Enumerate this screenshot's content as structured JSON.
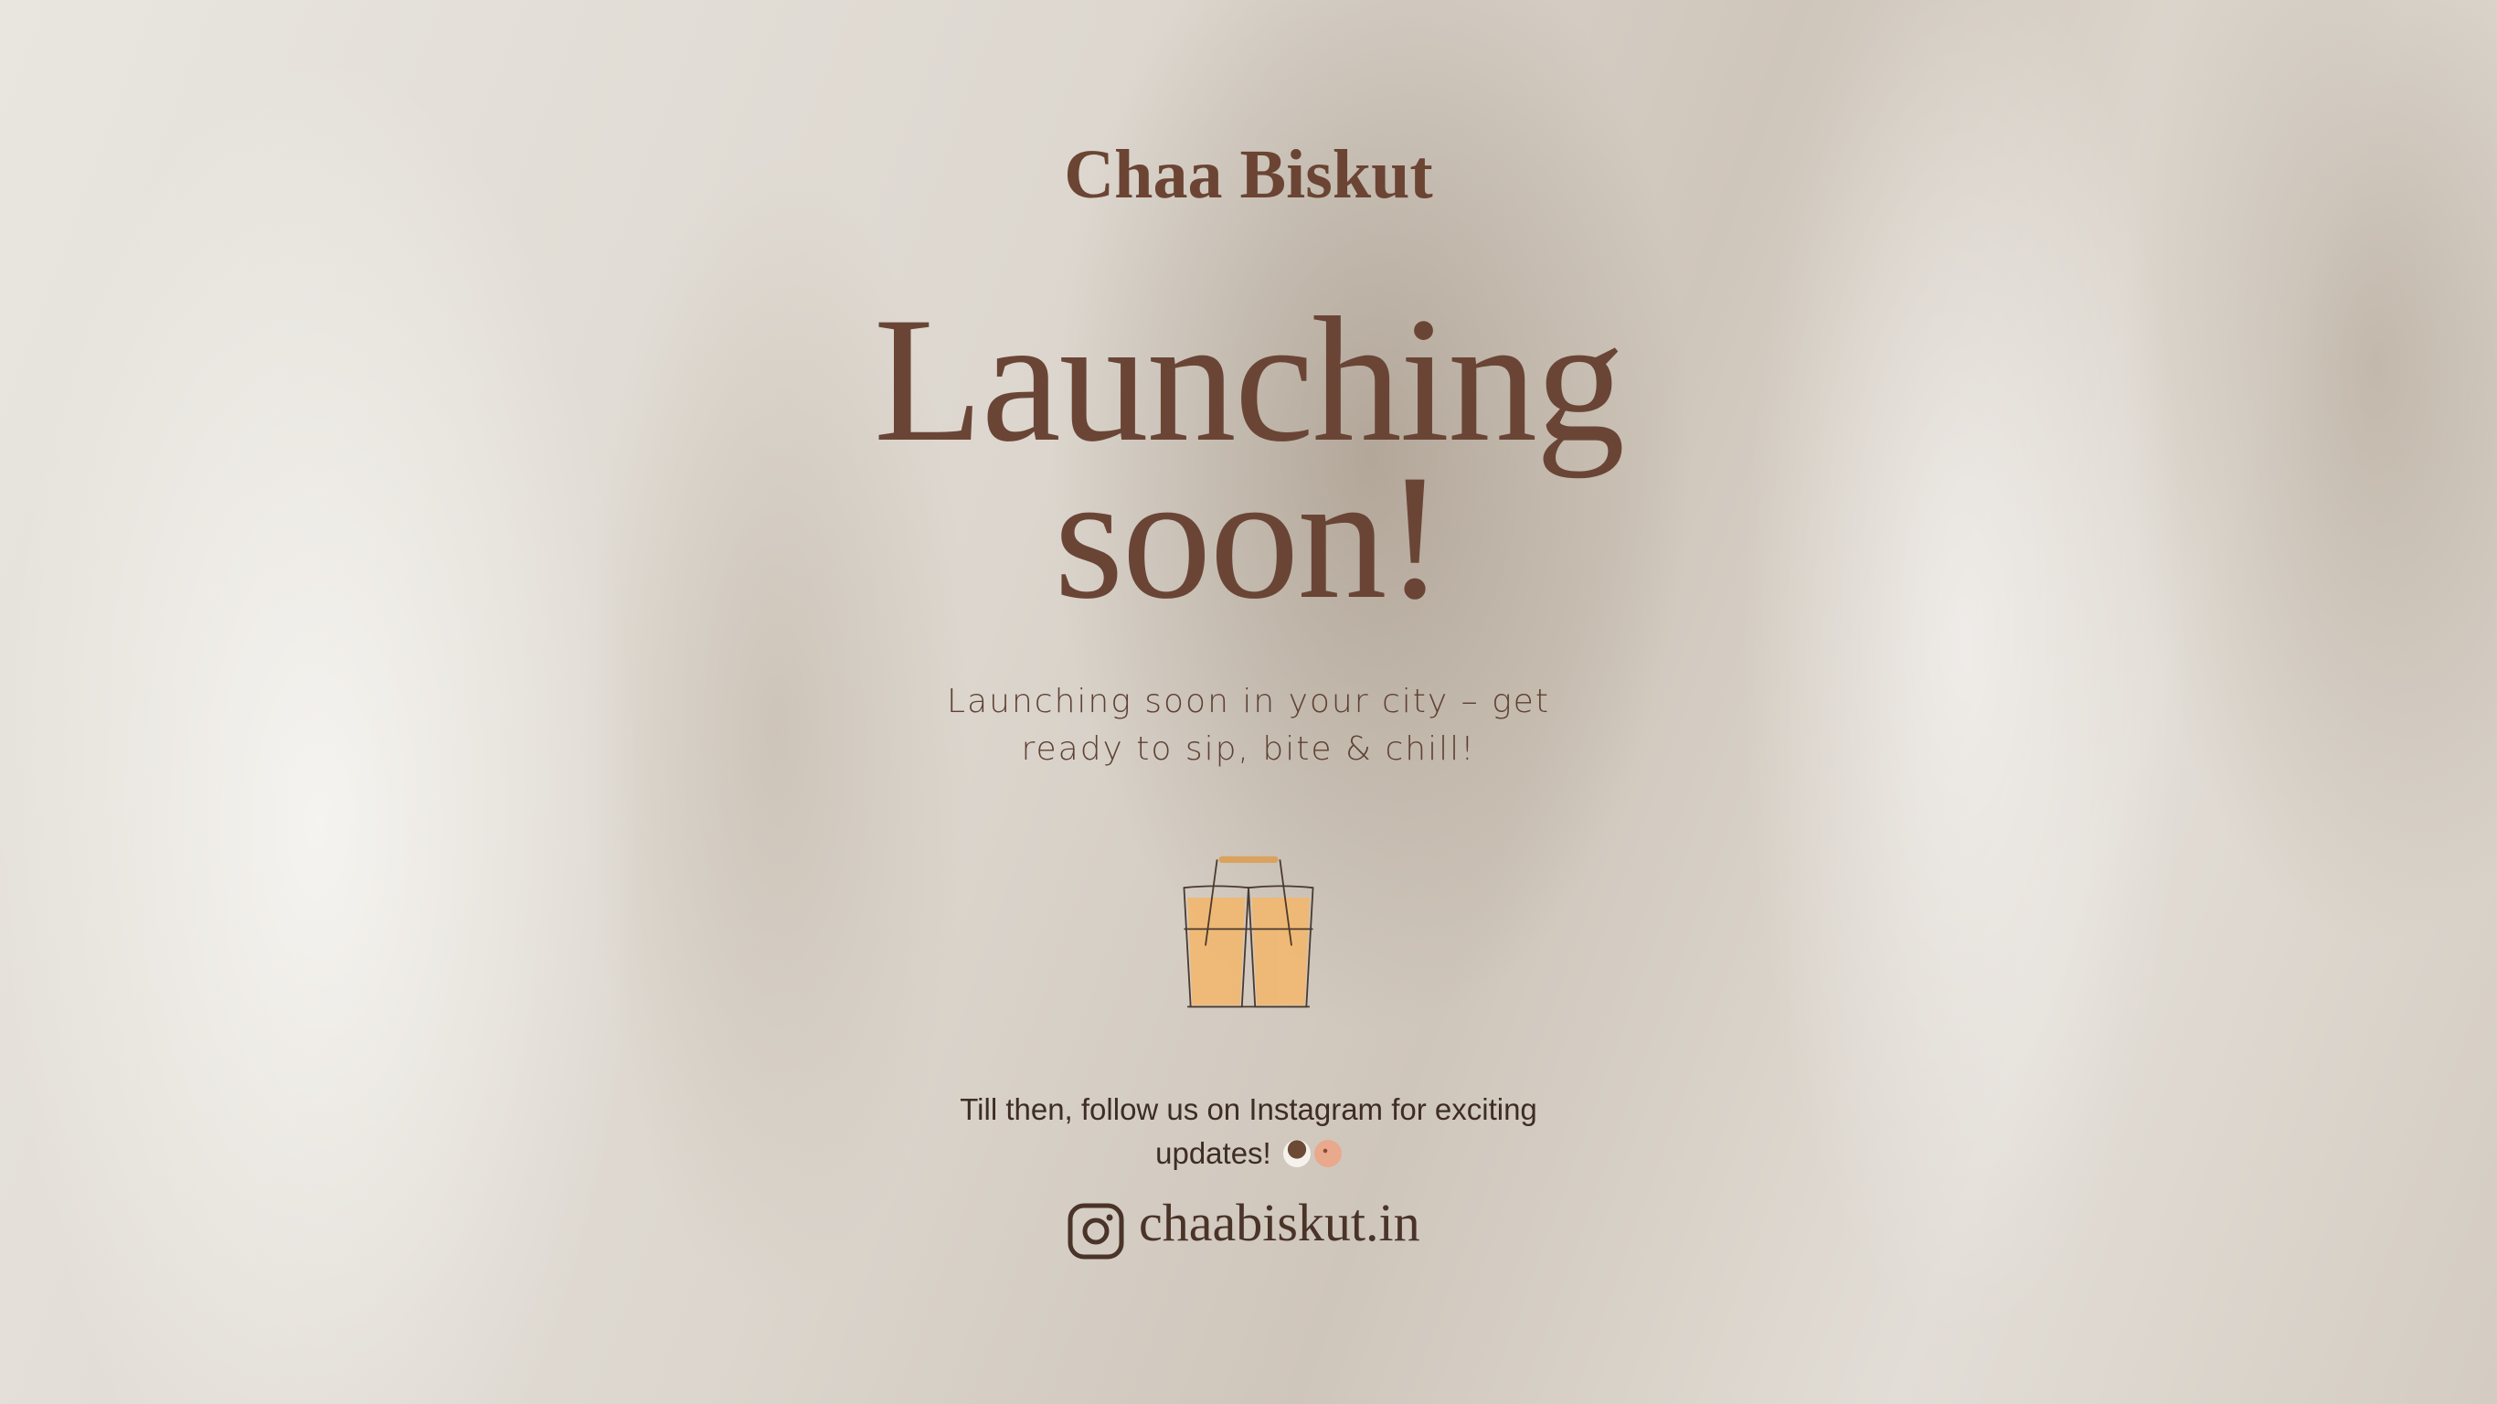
{
  "brand": "Chaa Biskut",
  "headline": {
    "line1": "Launching",
    "line2": "soon!"
  },
  "subtitle": {
    "line1": "Launching soon in your city – get",
    "line2": "ready to sip, bite & chill!"
  },
  "illustration": "chai-glasses-carrier-icon",
  "follow": {
    "line1": "Till then, follow us on Instagram for exciting",
    "line2": "updates!",
    "emojis": [
      "tea-cup-icon",
      "cookie-icon"
    ]
  },
  "instagram": {
    "icon": "instagram-icon",
    "handle": "chaabiskut.in"
  },
  "colors": {
    "brand": "#6b4433",
    "chai": "#f0b56a"
  }
}
